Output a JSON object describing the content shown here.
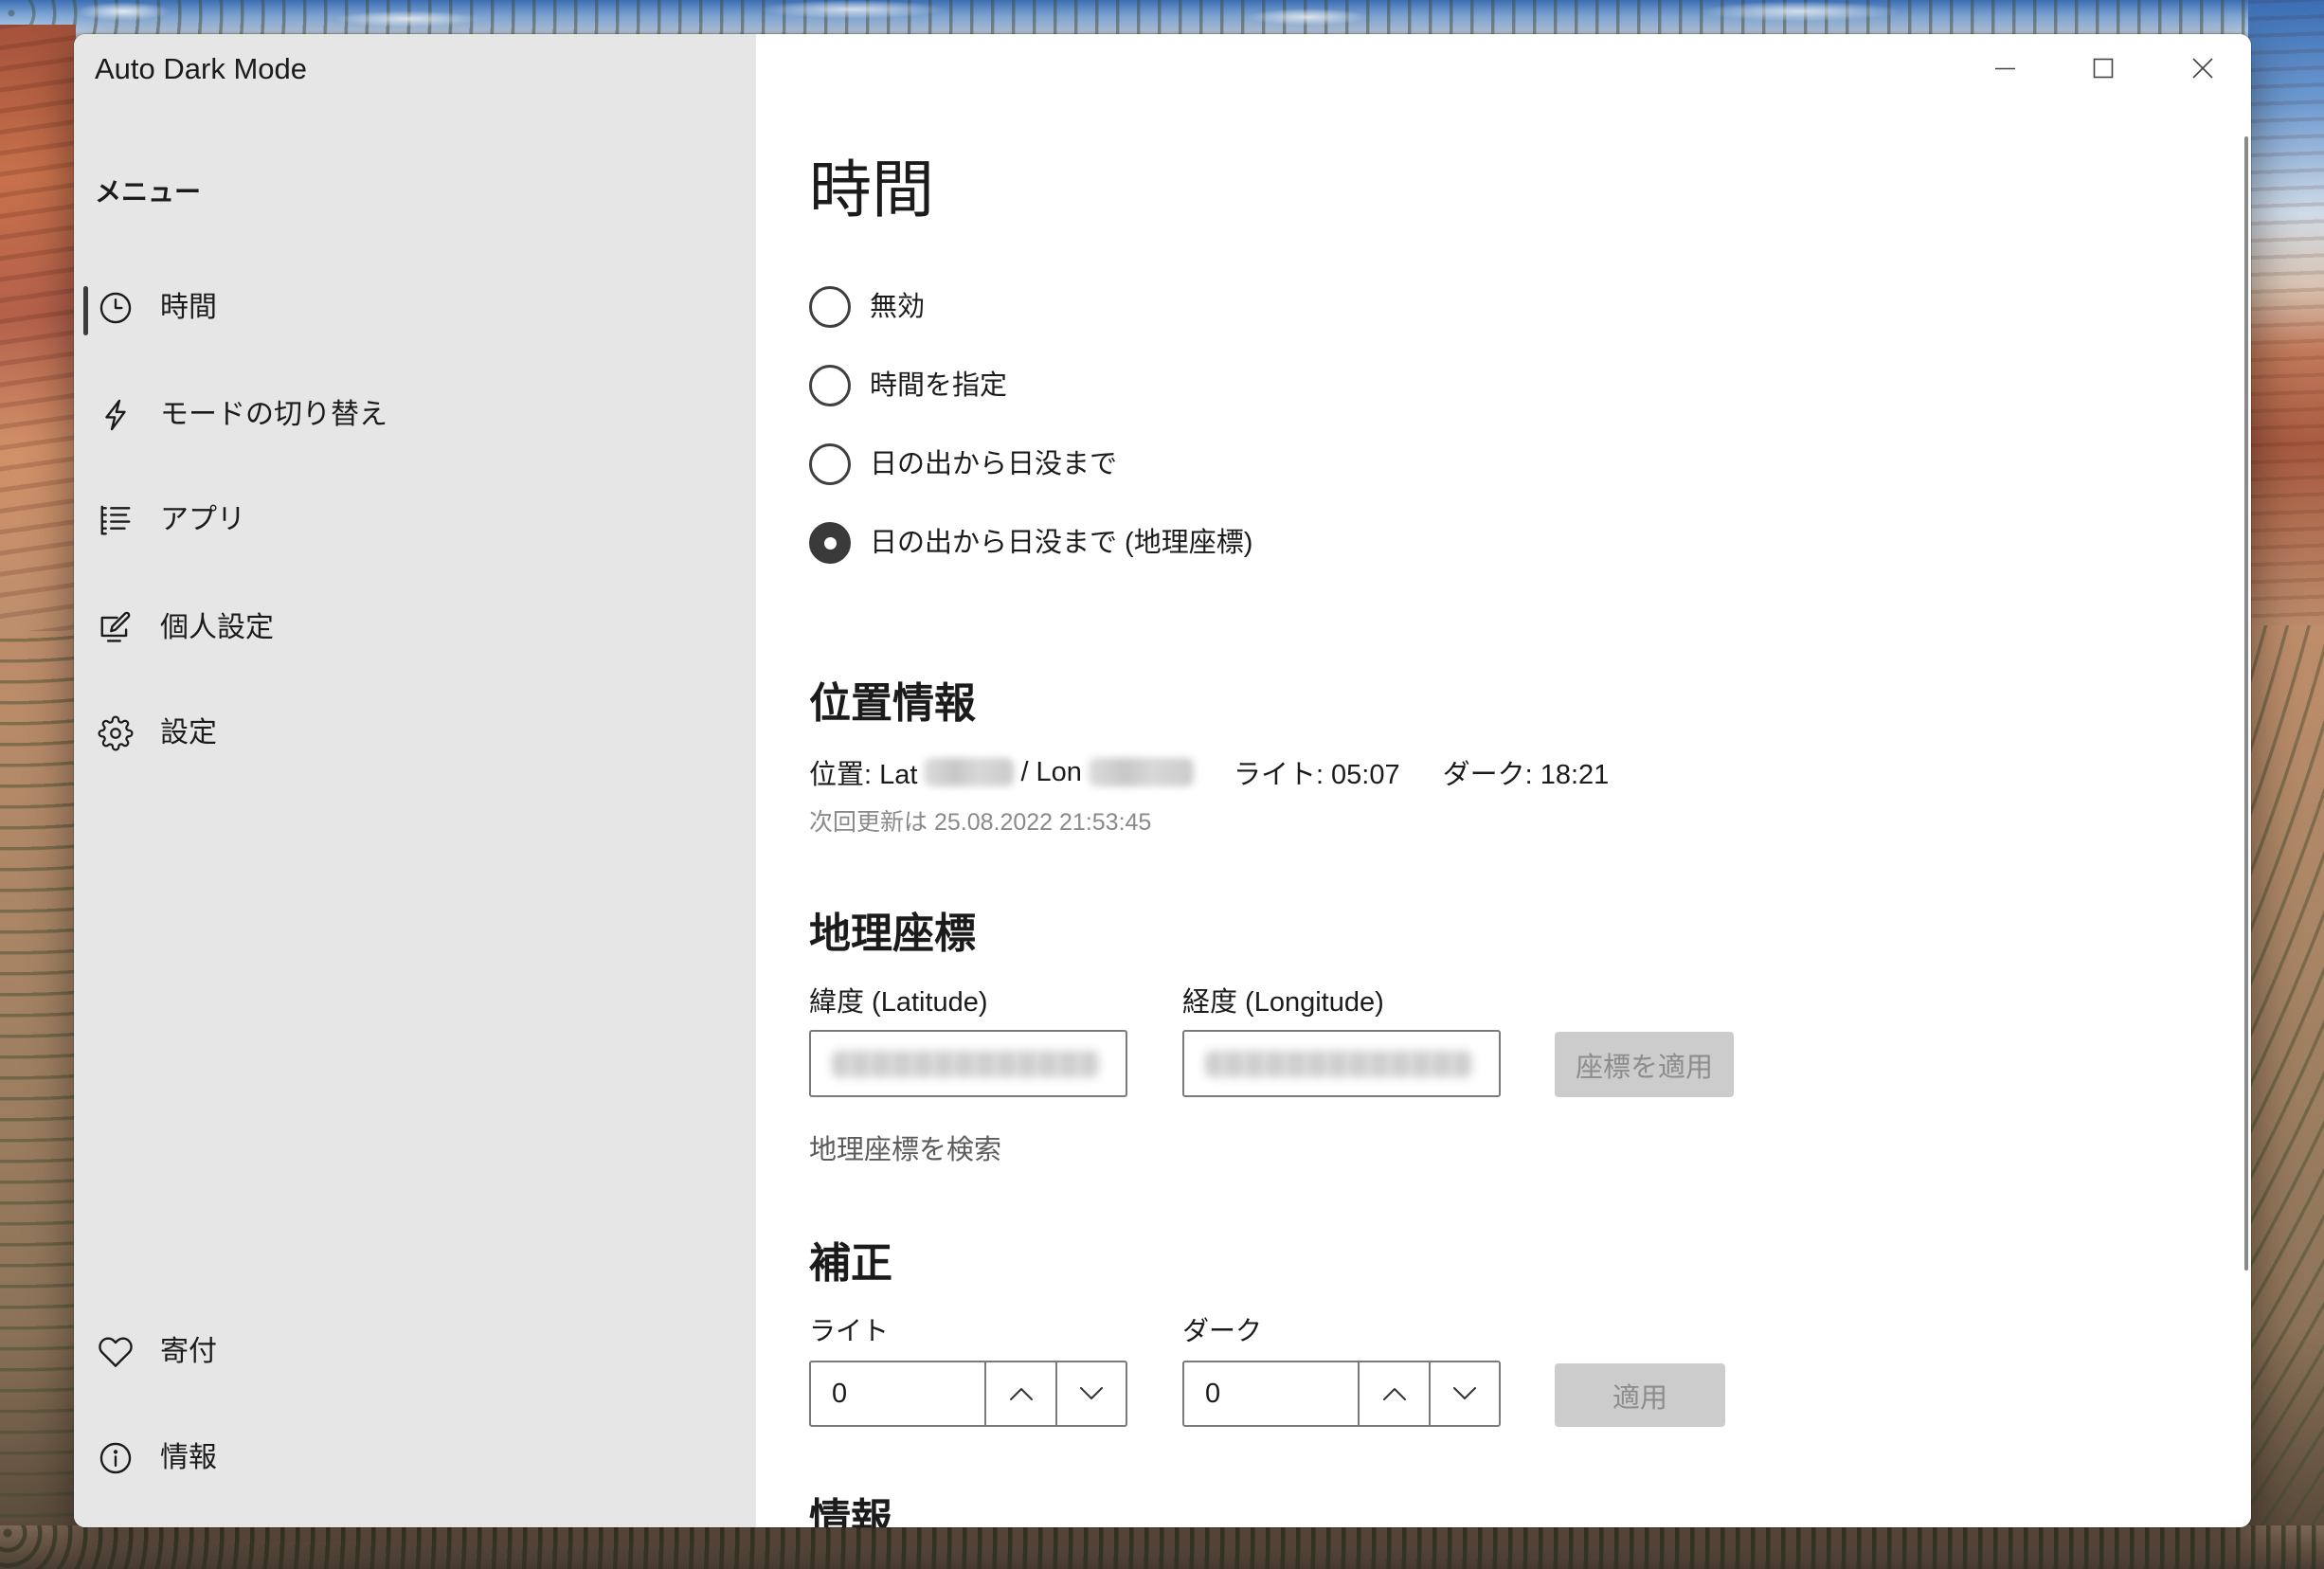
{
  "window": {
    "title": "Auto Dark Mode",
    "controls": {
      "minimize": "minimize-icon",
      "maximize": "maximize-icon",
      "close": "close-icon"
    }
  },
  "sidebar": {
    "menu_label": "メニュー",
    "selected_index": 0,
    "items": [
      {
        "label": "時間",
        "icon": "clock-icon"
      },
      {
        "label": "モードの切り替え",
        "icon": "lightning-icon"
      },
      {
        "label": "アプリ",
        "icon": "list-icon"
      },
      {
        "label": "個人設定",
        "icon": "personalize-icon"
      },
      {
        "label": "設定",
        "icon": "gear-icon"
      }
    ],
    "footer_items": [
      {
        "label": "寄付",
        "icon": "heart-icon"
      },
      {
        "label": "情報",
        "icon": "info-icon"
      }
    ]
  },
  "main": {
    "title": "時間",
    "modes": [
      {
        "label": "無効",
        "checked": false
      },
      {
        "label": "時間を指定",
        "checked": false
      },
      {
        "label": "日の出から日没まで",
        "checked": false
      },
      {
        "label": "日の出から日没まで (地理座標)",
        "checked": true
      }
    ],
    "location": {
      "heading": "位置情報",
      "lat_prefix": "位置: Lat",
      "lon_prefix": "/ Lon",
      "light_time": "ライト: 05:07",
      "dark_time": "ダーク: 18:21",
      "next_update": "次回更新は 25.08.2022 21:53:45"
    },
    "coordinates": {
      "heading": "地理座標",
      "latitude_label": "緯度 (Latitude)",
      "longitude_label": "経度 (Longitude)",
      "apply_label": "座標を適用",
      "search_link": "地理座標を検索"
    },
    "offset": {
      "heading": "補正",
      "light_label": "ライト",
      "light_value": "0",
      "dark_label": "ダーク",
      "dark_value": "0",
      "apply_label": "適用"
    },
    "info_heading": "情報"
  },
  "colors": {
    "sidebar_bg": "#e6e6e6",
    "main_bg": "#ffffff",
    "text": "#1b1b1b",
    "muted_text": "#8a8a8a",
    "link_text": "#5c5c5c",
    "disabled_button_bg": "#cccccc",
    "disabled_button_text": "#8c8c8c",
    "control_border": "#7a7a7a",
    "radio_checked": "#3a3a3a"
  }
}
